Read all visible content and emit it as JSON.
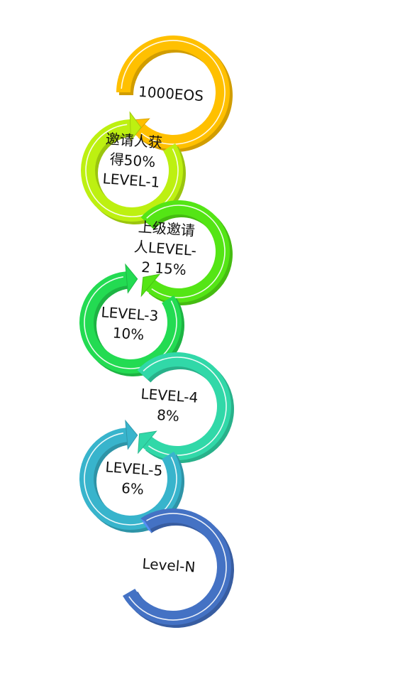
{
  "steps": [
    {
      "lines": [
        "1000EOS"
      ],
      "color": "#FFC000"
    },
    {
      "lines": [
        "邀请人获",
        "得50%",
        "LEVEL-1"
      ],
      "color": "#BDF011"
    },
    {
      "lines": [
        "上级邀请",
        "人LEVEL-",
        "2 15%"
      ],
      "color": "#54E515"
    },
    {
      "lines": [
        "LEVEL-3",
        "10%"
      ],
      "color": "#23DB52"
    },
    {
      "lines": [
        "LEVEL-4",
        "8%"
      ],
      "color": "#31D8A8"
    },
    {
      "lines": [
        "LEVEL-5",
        "6%"
      ],
      "color": "#38B4CC"
    },
    {
      "lines": [
        "Level-N"
      ],
      "color": "#4472C4"
    }
  ]
}
